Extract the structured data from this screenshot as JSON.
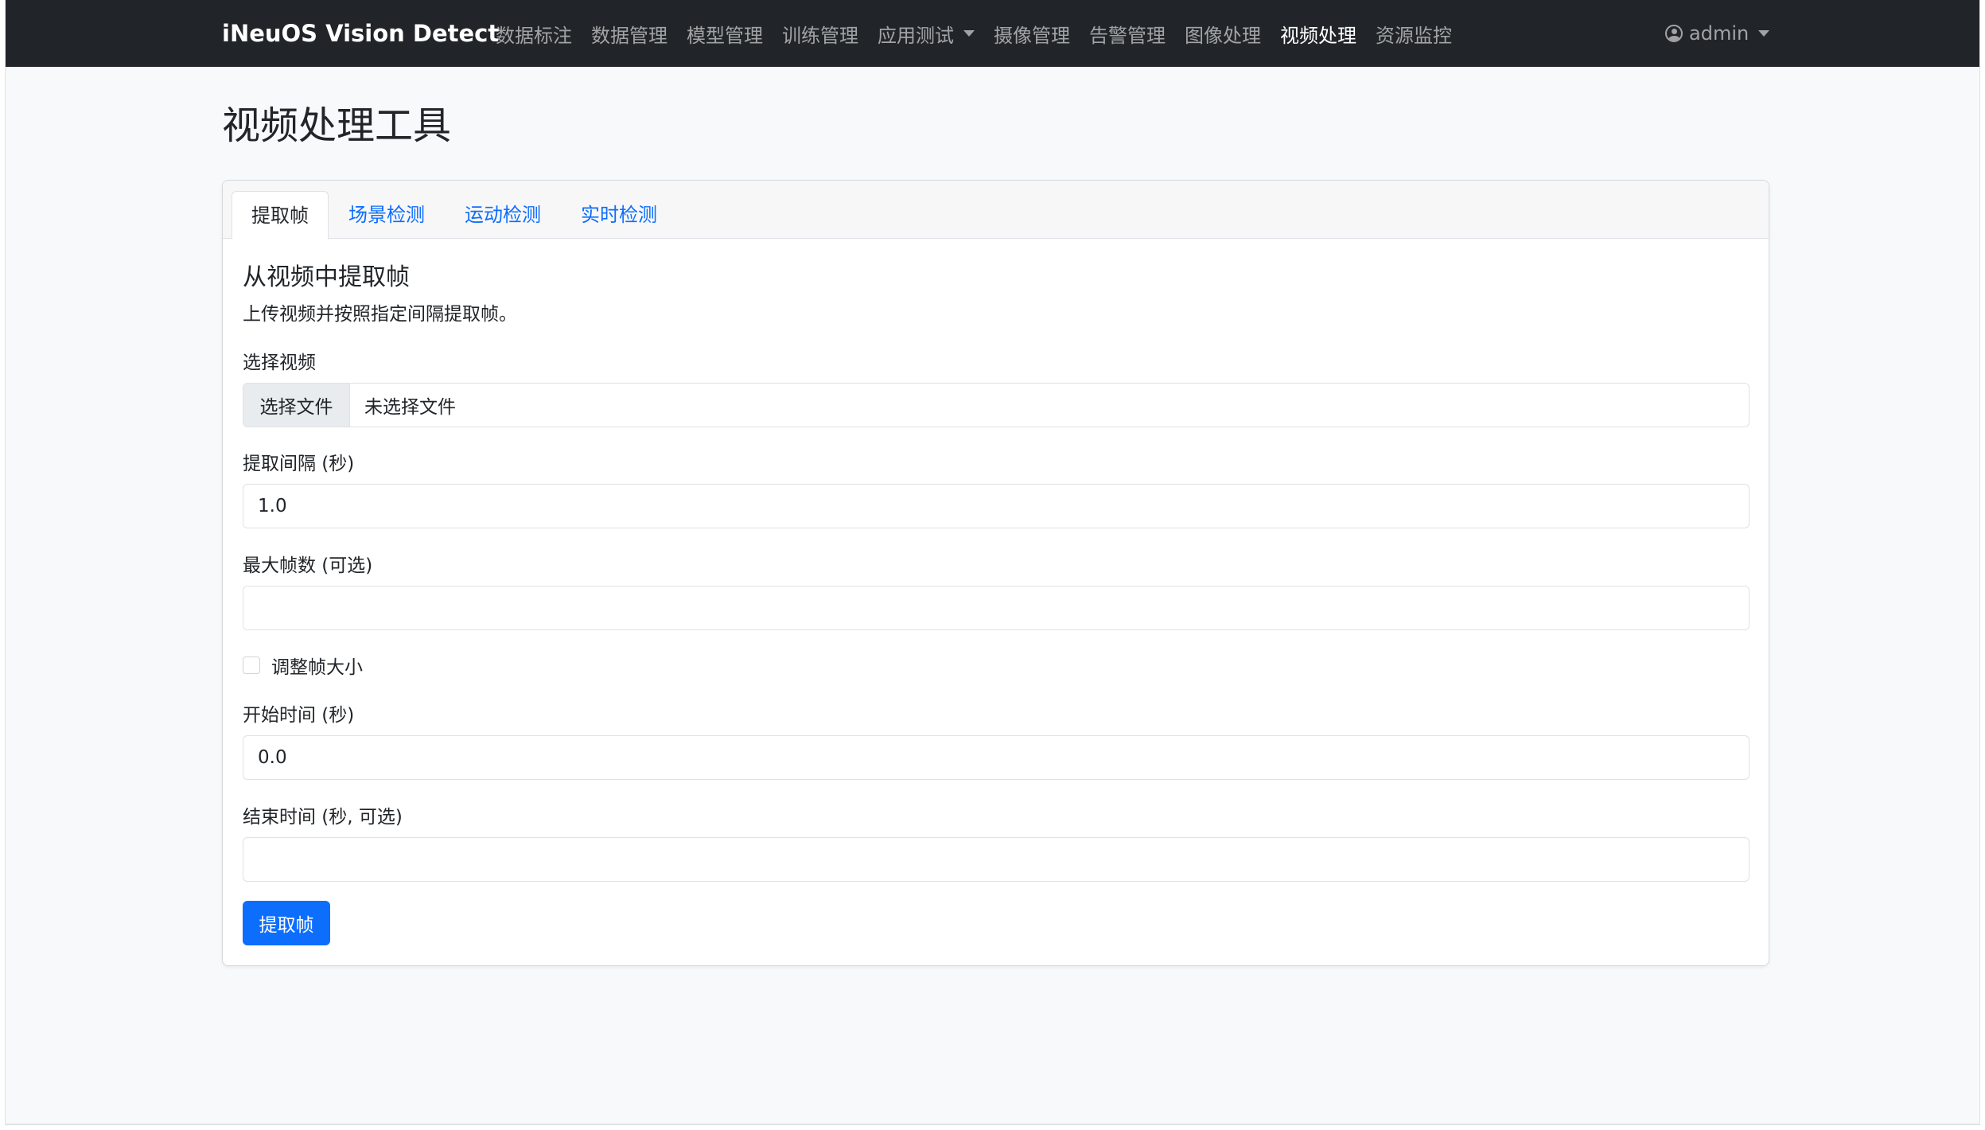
{
  "navbar": {
    "brand": "iNeuOS Vision Detect",
    "items": [
      {
        "label": "数据标注"
      },
      {
        "label": "数据管理"
      },
      {
        "label": "模型管理"
      },
      {
        "label": "训练管理"
      },
      {
        "label": "应用测试",
        "dropdown": true
      },
      {
        "label": "摄像管理"
      },
      {
        "label": "告警管理"
      },
      {
        "label": "图像处理"
      },
      {
        "label": "视频处理",
        "active": true
      },
      {
        "label": "资源监控"
      }
    ],
    "user": {
      "name": "admin",
      "icon": "user-circle-icon"
    }
  },
  "page": {
    "title": "视频处理工具"
  },
  "tabs": [
    {
      "label": "提取帧",
      "active": true
    },
    {
      "label": "场景检测"
    },
    {
      "label": "运动检测"
    },
    {
      "label": "实时检测"
    }
  ],
  "extract": {
    "title": "从视频中提取帧",
    "description": "上传视频并按照指定间隔提取帧。",
    "video_label": "选择视频",
    "file_button": "选择文件",
    "file_status": "未选择文件",
    "interval_label": "提取间隔 (秒)",
    "interval_value": "1.0",
    "max_frames_label": "最大帧数 (可选)",
    "max_frames_value": "",
    "resize_label": "调整帧大小",
    "resize_checked": false,
    "start_label": "开始时间 (秒)",
    "start_value": "0.0",
    "end_label": "结束时间 (秒, 可选)",
    "end_value": "",
    "submit": "提取帧"
  },
  "colors": {
    "navbar_bg": "#212529",
    "primary": "#0d6efd",
    "page_bg": "#f8f9fa"
  }
}
